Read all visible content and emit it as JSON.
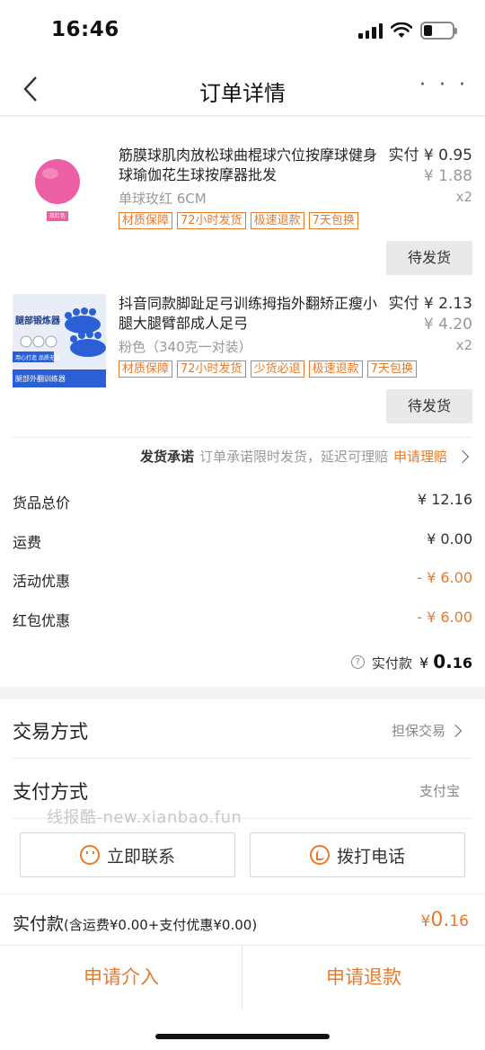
{
  "status": {
    "time": "16:46"
  },
  "header": {
    "title": "订单详情",
    "more": "· · ·"
  },
  "items": [
    {
      "title": "筋膜球肌肉放松球曲棍球穴位按摩球健身球瑜伽花生球按摩器批发",
      "price": "实付 ¥ 0.95",
      "orig_price": "¥ 1.88",
      "spec": "单球玫红 6CM",
      "qty": "x2",
      "image_label": "玫红色",
      "tags": [
        "材质保障",
        "72小时发货",
        "极速退款",
        "7天包换"
      ],
      "status_button": "待发货"
    },
    {
      "title": "抖音同款脚趾足弓训练拇指外翻矫正瘦小腿大腿臂部成人足弓",
      "price": "实付 ¥ 2.13",
      "orig_price": "¥ 4.20",
      "spec": "粉色（340克一对装）",
      "qty": "x2",
      "image_label": "腿部锻炼器",
      "image_sub": "用心打造 品质无忧",
      "image_footer": "腿部外翻训练器",
      "tags": [
        "材质保障",
        "72小时发货",
        "少货必退",
        "极速退款",
        "7天包换"
      ],
      "status_button": "待发货"
    }
  ],
  "promise": {
    "label": "发货承诺",
    "text": "订单承诺限时发货，延迟可理赔",
    "link": "申请理赔"
  },
  "fees": [
    {
      "label": "货品总价",
      "value": "¥ 12.16"
    },
    {
      "label": "运费",
      "value": "¥ 0.00"
    },
    {
      "label": "活动优惠",
      "value": "- ¥ 6.00"
    },
    {
      "label": "红包优惠",
      "value": "- ¥ 6.00"
    }
  ],
  "paid": {
    "label": "实付款",
    "currency": "¥",
    "integer": "0.",
    "decimal": "16"
  },
  "trade": {
    "label": "交易方式",
    "value": "担保交易"
  },
  "payment": {
    "label": "支付方式",
    "value": "支付宝"
  },
  "watermark": "线报酷-new.xianbao.fun",
  "contact": {
    "chat": "立即联系",
    "call": "拨打电话"
  },
  "total": {
    "label": "实付款",
    "detail": "(含运费¥0.00+支付优惠¥0.00)",
    "currency": "¥",
    "integer": "0.",
    "decimal": "16"
  },
  "actions": {
    "intervene": "申请介入",
    "refund": "申请退款"
  },
  "colors": {
    "accent": "#e87a2a",
    "pink_ball": "#ec5fa5",
    "blue_product": "#2a5fd6"
  }
}
